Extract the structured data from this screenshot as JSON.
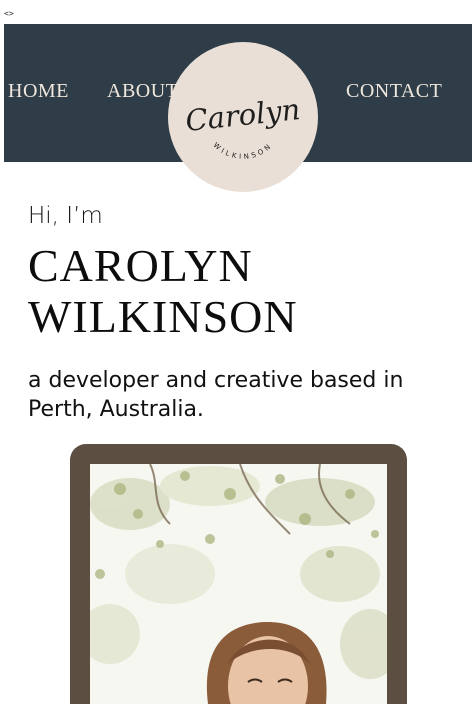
{
  "page": {
    "corner_tag": "<>"
  },
  "nav": {
    "items": [
      {
        "label": "HOME"
      },
      {
        "label": "ABOUT"
      },
      {
        "label": "CONTACT"
      }
    ],
    "logo": {
      "script_text": "Carolyn",
      "sub_text": "WILKINSON"
    }
  },
  "hero": {
    "greeting": "Hi, I’m",
    "name_line1": "CAROLYN",
    "name_line2": "WILKINSON",
    "tagline": "a developer and creative based in Perth, Australia."
  },
  "colors": {
    "nav_bg": "#2e3d47",
    "nav_text": "#efe6dc",
    "logo_bg": "#eadfd6",
    "frame": "#5c4f41"
  }
}
